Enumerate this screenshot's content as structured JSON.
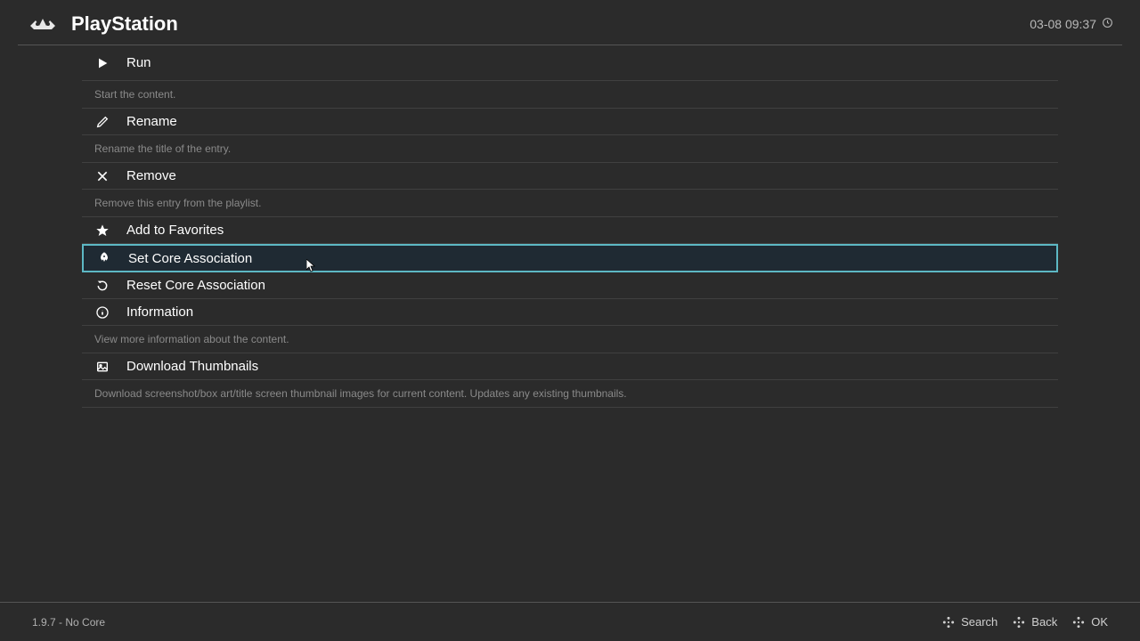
{
  "header": {
    "title": "PlayStation",
    "datetime": "03-08 09:37"
  },
  "menu": {
    "run": {
      "label": "Run",
      "desc": "Start the content."
    },
    "rename": {
      "label": "Rename",
      "desc": "Rename the title of the entry."
    },
    "remove": {
      "label": "Remove",
      "desc": "Remove this entry from the playlist."
    },
    "favorites": {
      "label": "Add to Favorites"
    },
    "setcore": {
      "label": "Set Core Association"
    },
    "resetcore": {
      "label": "Reset Core Association"
    },
    "info": {
      "label": "Information",
      "desc": "View more information about the content."
    },
    "thumbs": {
      "label": "Download Thumbnails",
      "desc": "Download screenshot/box art/title screen thumbnail images for current content. Updates any existing thumbnails."
    }
  },
  "footer": {
    "version": "1.9.7 - No Core",
    "search": "Search",
    "back": "Back",
    "ok": "OK"
  }
}
